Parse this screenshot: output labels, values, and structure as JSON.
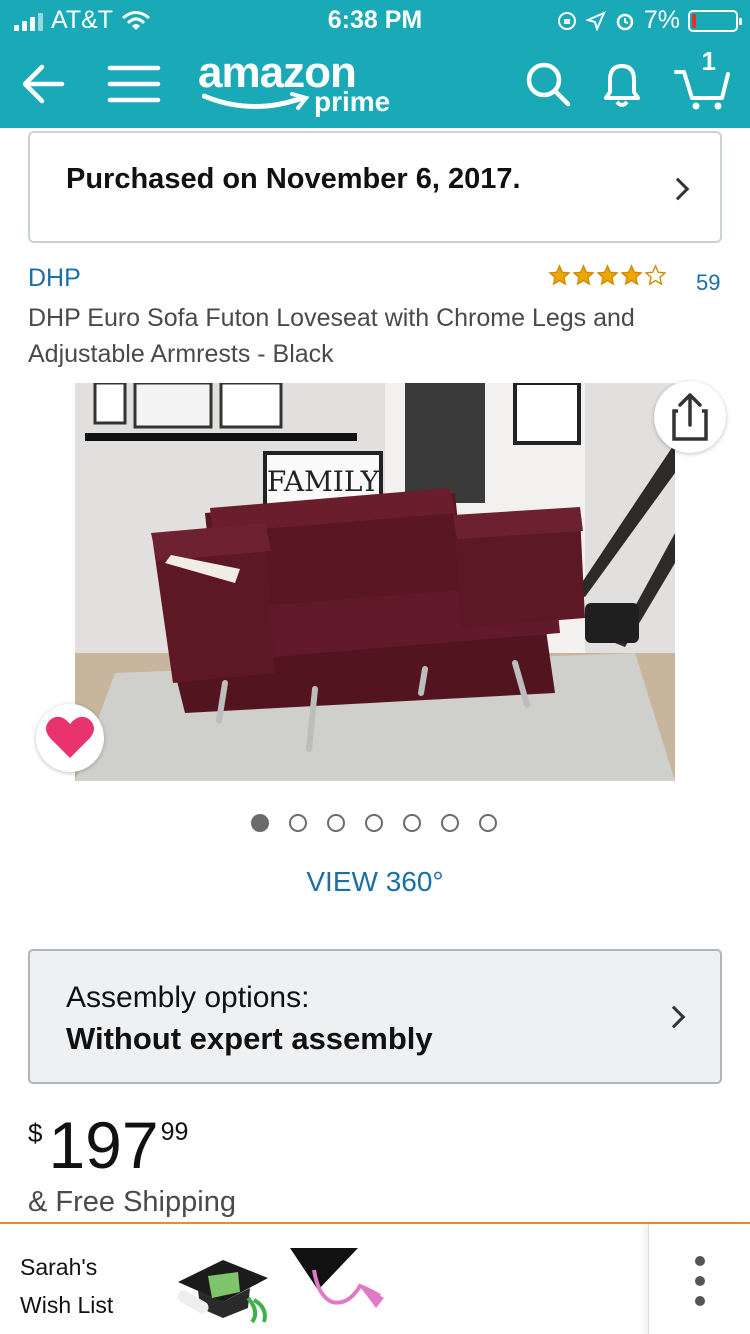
{
  "status_bar": {
    "carrier": "AT&T",
    "time": "6:38 PM",
    "battery_percent": "7%",
    "battery_level": 0.07
  },
  "nav": {
    "logo_word": "amazon",
    "logo_sub": "prime",
    "cart_count": "1",
    "icons": [
      "back-arrow-icon",
      "menu-icon",
      "search-icon",
      "bell-icon",
      "cart-icon"
    ]
  },
  "purchased": {
    "text": "Purchased on November 6, 2017."
  },
  "product": {
    "brand": "DHP",
    "rating": 4.0,
    "rating_max": 5,
    "review_count": "59",
    "title": "DHP Euro Sofa Futon Loveseat with Chrome Legs and Adjustable Armrests - Black",
    "image_caption": "FAMILY",
    "image_count": 7,
    "active_image": 0,
    "view360_label": "VIEW 360°"
  },
  "assembly": {
    "label": "Assembly options:",
    "value": "Without expert assembly"
  },
  "price": {
    "currency": "$",
    "whole": "197",
    "fraction": "99",
    "shipping": "& Free Shipping"
  },
  "bottom_bar": {
    "wishlist_line1": "Sarah's",
    "wishlist_line2": "Wish List"
  },
  "colors": {
    "header": "#1aa9b7",
    "link": "#1b6fa8",
    "star": "#f0a400",
    "heart": "#e8336e",
    "bottom_border": "#f08a24",
    "sofa": "#5a1722"
  }
}
